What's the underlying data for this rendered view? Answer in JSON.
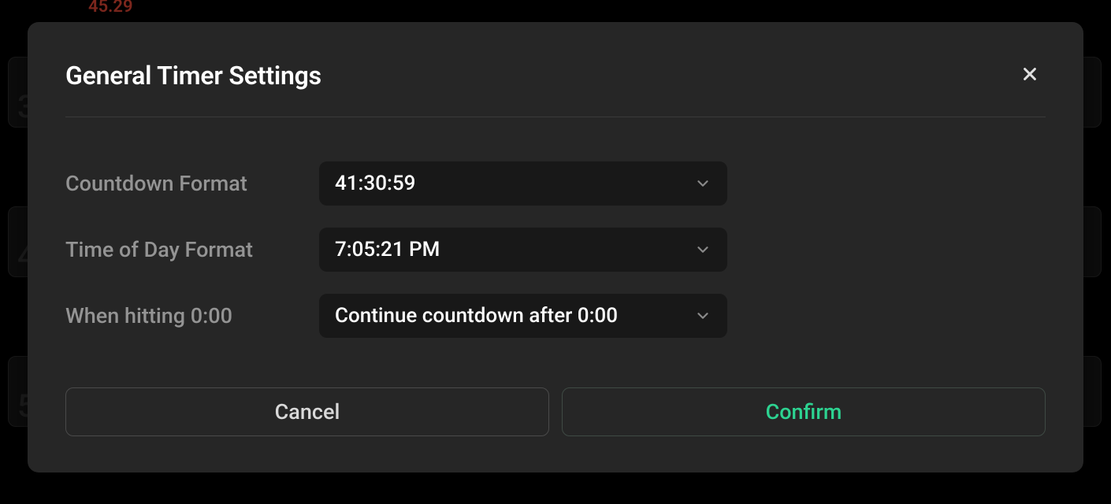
{
  "background": {
    "red_time": "45.29",
    "row_numbers": [
      "3",
      "4",
      "5"
    ]
  },
  "modal": {
    "title": "General Timer Settings",
    "fields": {
      "countdown_format": {
        "label": "Countdown Format",
        "value": "41:30:59"
      },
      "time_of_day_format": {
        "label": "Time of Day Format",
        "value": "7:05:21 PM"
      },
      "when_hitting_zero": {
        "label": "When hitting 0:00",
        "value": "Continue countdown after 0:00"
      }
    },
    "buttons": {
      "cancel": "Cancel",
      "confirm": "Confirm"
    }
  }
}
